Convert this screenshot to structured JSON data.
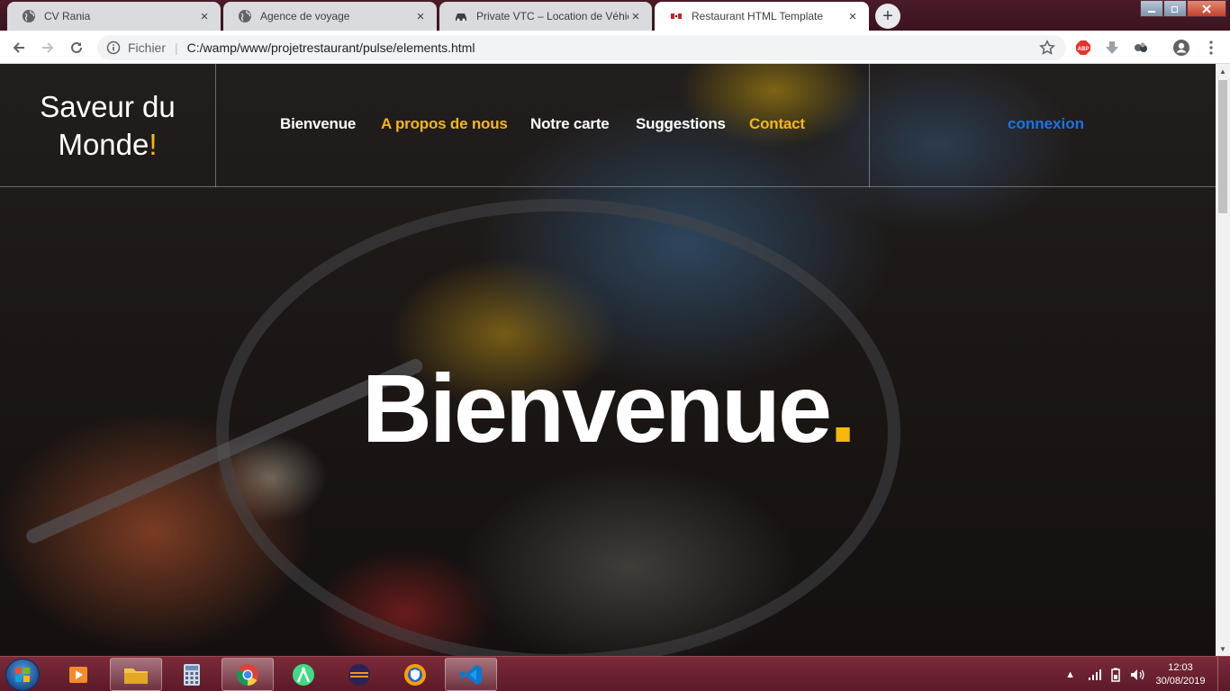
{
  "browser": {
    "tabs": [
      {
        "title": "CV Rania",
        "icon": "globe-icon",
        "active": false
      },
      {
        "title": "Agence de voyage",
        "icon": "globe-icon",
        "active": false
      },
      {
        "title": "Private VTC – Location de Véhicu",
        "icon": "car-icon",
        "active": false
      },
      {
        "title": "Restaurant HTML Template",
        "icon": "flag-icon",
        "active": true
      }
    ],
    "new_tab_label": "+",
    "address": {
      "scheme_label": "Fichier",
      "url": "C:/wamp/www/projetrestaurant/pulse/elements.html"
    }
  },
  "site": {
    "logo": {
      "line1": "Saveur du",
      "line2": "Monde",
      "accent": "!"
    },
    "nav": [
      {
        "label": "Bienvenue",
        "color": "#ffffff"
      },
      {
        "label": "A propos de nous",
        "color": "#f5b80f"
      },
      {
        "label": "Notre carte",
        "color": "#ffffff"
      },
      {
        "label": "Suggestions",
        "color": "#ffffff"
      },
      {
        "label": "Contact",
        "color": "#f5b80f"
      }
    ],
    "login_label": "connexion",
    "hero": {
      "title": "Bienvenue",
      "accent": "."
    },
    "accent_color": "#f5b80f"
  },
  "taskbar": {
    "apps": [
      "media-player-icon",
      "file-explorer-icon",
      "calculator-icon",
      "chrome-icon",
      "android-studio-icon",
      "eclipse-icon",
      "browser-shield-icon",
      "vscode-icon"
    ],
    "clock": {
      "time": "12:03",
      "date": "30/08/2019"
    }
  }
}
